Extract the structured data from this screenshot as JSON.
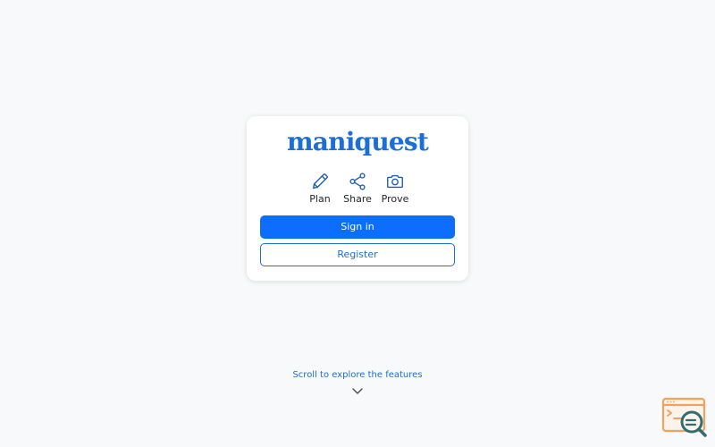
{
  "app": {
    "logo_text": "maniquest"
  },
  "features": [
    {
      "label": "Plan",
      "icon": "pencil-icon"
    },
    {
      "label": "Share",
      "icon": "share-icon"
    },
    {
      "label": "Prove",
      "icon": "camera-icon"
    }
  ],
  "auth": {
    "sign_in_label": "Sign in",
    "register_label": "Register"
  },
  "scroll": {
    "hint": "Scroll to explore the features",
    "icon": "chevron-down-icon"
  },
  "widget": {
    "icon": "code-search-icon"
  },
  "colors": {
    "brand": "#1b6fd6",
    "primary": "#0d6efd",
    "background": "#f8f9fa",
    "widget_orange": "#f0a35e",
    "widget_teal": "#2f6f73"
  }
}
